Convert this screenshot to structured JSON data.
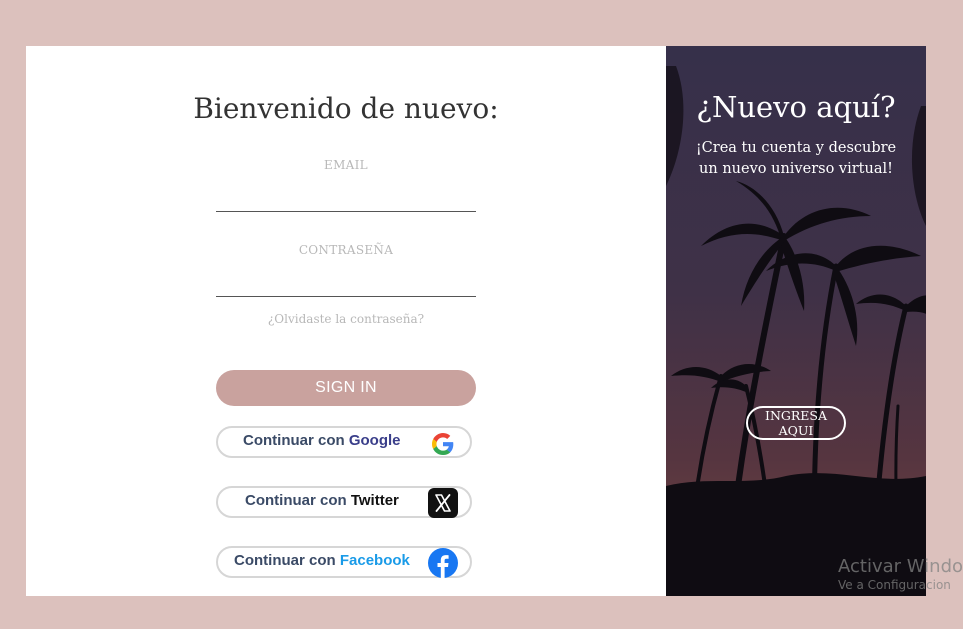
{
  "login": {
    "title": "Bienvenido de nuevo:",
    "email_label": "EMAIL",
    "email_value": "",
    "password_label": "CONTRASEÑA",
    "password_value": "",
    "forgot_link": "¿Olvidaste la contraseña?",
    "signin_label": "SIGN IN",
    "social": {
      "google": {
        "prefix": "Continuar con",
        "brand": "Google",
        "brand_color": "#3a3e8a",
        "icon": "google-icon"
      },
      "twitter": {
        "prefix": "Continuar con",
        "brand": "Twitter",
        "brand_color": "#111111",
        "icon": "x-twitter-icon"
      },
      "facebook": {
        "prefix": "Continuar con",
        "brand": "Facebook",
        "brand_color": "#1a9be8",
        "icon": "facebook-icon"
      }
    }
  },
  "signup": {
    "title": "¿Nuevo aquí?",
    "subtitle": "¡Crea tu cuenta y descubre un nuevo universo virtual!",
    "button_label": "INGRESA AQUI"
  },
  "watermark": {
    "line1": "Activar Windo",
    "line2": "Ve a Configuracion"
  },
  "colors": {
    "page_bg": "#dcc1bd",
    "signin_bg": "#c9a29e",
    "panel_bg": "#3e2f45"
  }
}
